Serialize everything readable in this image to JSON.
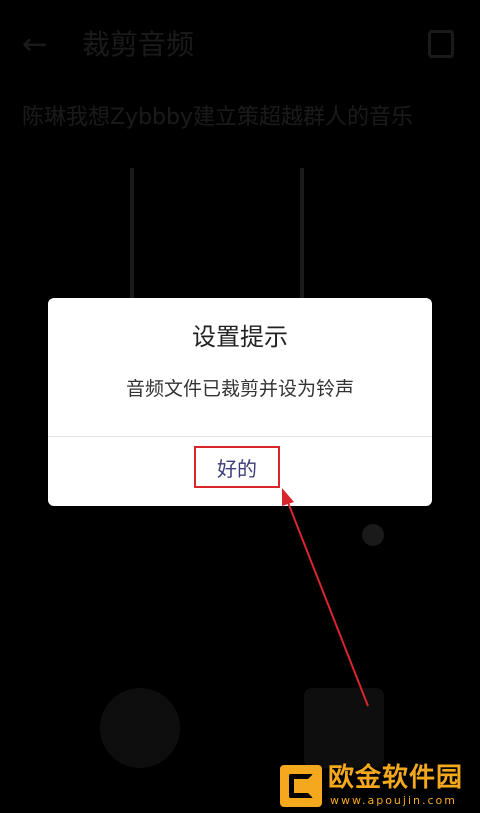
{
  "background": {
    "title": "裁剪音频",
    "filename": "陈琳我想Zybbby建立策超越群人的音乐"
  },
  "dialog": {
    "title": "设置提示",
    "message": "音频文件已裁剪并设为铃声",
    "ok_label": "好的"
  },
  "watermark": {
    "name": "欧金软件园",
    "url": "www.apoujin.com"
  },
  "colors": {
    "highlight_box": "#d9262c",
    "arrow": "#d9262c",
    "button_text": "#3c3c7a",
    "watermark": "#f3a81d"
  }
}
